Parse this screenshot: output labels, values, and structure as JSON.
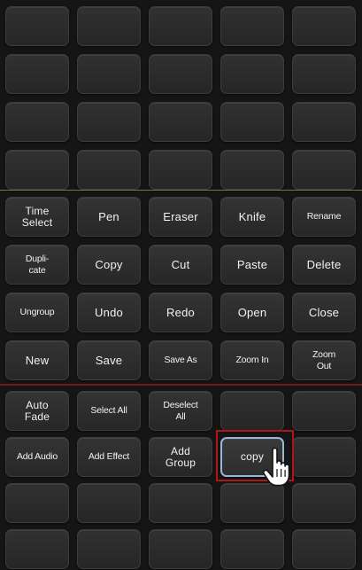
{
  "colors": {
    "panel_bg": "#151515",
    "button_bg": "#2e2e2e",
    "button_text": "#f2f2f2",
    "top_divider": "#7d7a2c",
    "bottom_divider": "#6e1b1b",
    "highlight": "#b01616",
    "active_border": "#9bb7d8"
  },
  "command_buttons": [
    {
      "label": "Time\nSelect"
    },
    {
      "label": "Pen"
    },
    {
      "label": "Eraser"
    },
    {
      "label": "Knife"
    },
    {
      "label": "Rename"
    },
    {
      "label": "Dupli-\ncate"
    },
    {
      "label": "Copy"
    },
    {
      "label": "Cut"
    },
    {
      "label": "Paste"
    },
    {
      "label": "Delete"
    },
    {
      "label": "Ungroup"
    },
    {
      "label": "Undo"
    },
    {
      "label": "Redo"
    },
    {
      "label": "Open"
    },
    {
      "label": "Close"
    },
    {
      "label": "New"
    },
    {
      "label": "Save"
    },
    {
      "label": "Save As"
    },
    {
      "label": "Zoom In"
    },
    {
      "label": "Zoom\nOut"
    }
  ],
  "custom_buttons": [
    {
      "label": "Auto\nFade"
    },
    {
      "label": "Select All"
    },
    {
      "label": "Deselect\nAll"
    },
    {
      "label": ""
    },
    {
      "label": ""
    },
    {
      "label": "Add Audio"
    },
    {
      "label": "Add Effect"
    },
    {
      "label": "Add\nGroup"
    },
    {
      "label": "copy"
    },
    {
      "label": ""
    }
  ],
  "cursor_icon": "hand-pointer-icon"
}
